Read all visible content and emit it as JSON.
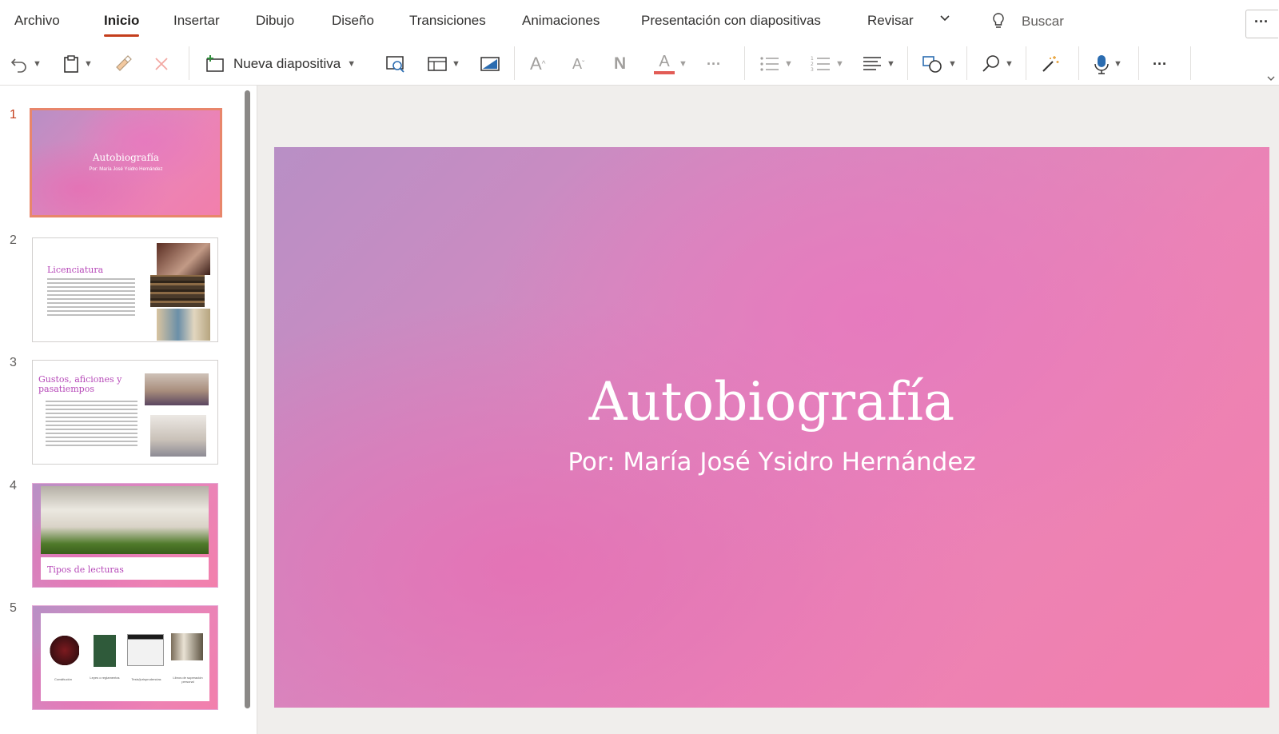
{
  "menu": {
    "tabs": [
      "Archivo",
      "Inicio",
      "Insertar",
      "Dibujo",
      "Diseño",
      "Transiciones",
      "Animaciones",
      "Presentación con diapositivas",
      "Revisar"
    ],
    "search_label": "Buscar",
    "more_label": "···"
  },
  "toolbar": {
    "new_slide_label": "Nueva diapositiva",
    "font_bold_glyph": "N",
    "font_color_glyph": "A",
    "grow_font_glyph": "A",
    "shrink_font_glyph": "A",
    "more_glyph": "···",
    "accent_color": "#e25c56"
  },
  "slides": [
    {
      "number": "1",
      "title": "Autobiografía",
      "subtitle": "Por: María José Ysidro Hernández"
    },
    {
      "number": "2",
      "title": "Licenciatura"
    },
    {
      "number": "3",
      "title": "Gustos, aficiones y pasatiempos"
    },
    {
      "number": "4",
      "title": "Tipos de lecturas"
    },
    {
      "number": "5",
      "captions": [
        "Constitución",
        "Leyes o reglamentos",
        "Tesis/jurisprudencias",
        "Libros de superación personal"
      ]
    }
  ],
  "current_slide": {
    "title": "Autobiografía",
    "subtitle": "Por: María José Ysidro Hernández"
  },
  "colors": {
    "active_tab_underline": "#c43e1c",
    "selected_thumb_border": "#e8866b",
    "slide_title_pink": "#b648b8"
  }
}
